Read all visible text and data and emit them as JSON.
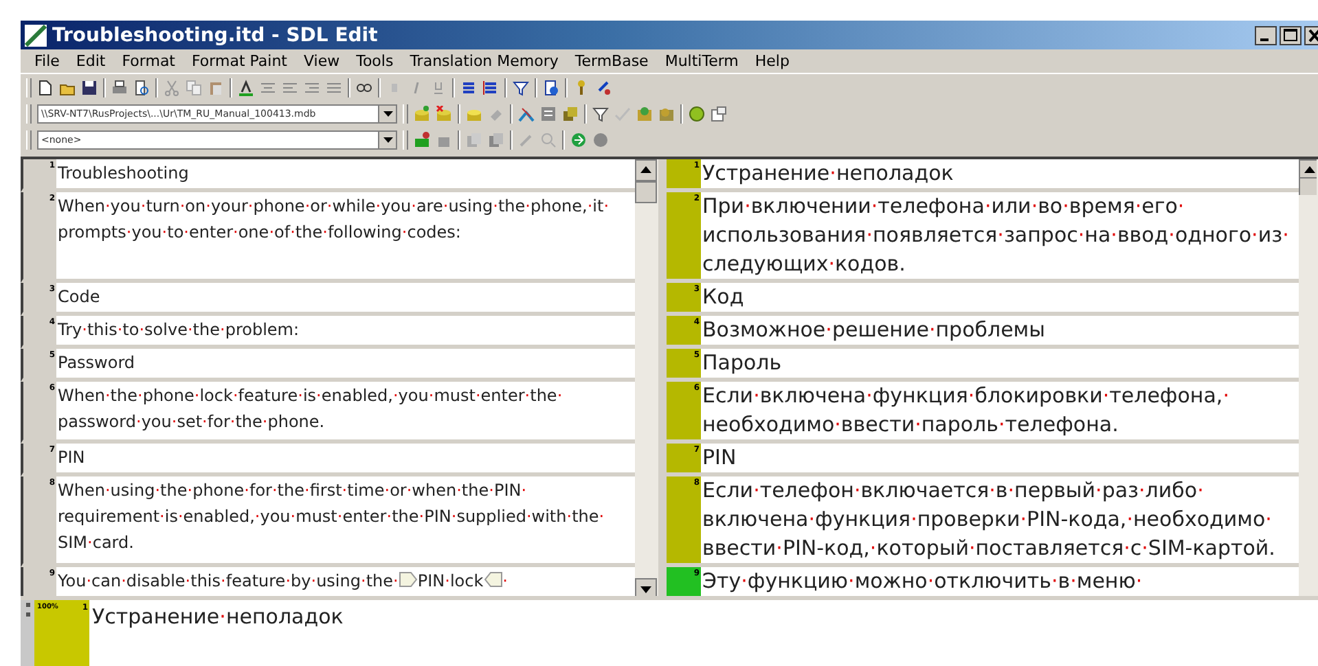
{
  "window": {
    "title": "Troubleshooting.itd - SDL Edit"
  },
  "menu": [
    "File",
    "Edit",
    "Format",
    "Format Paint",
    "View",
    "Tools",
    "Translation Memory",
    "TermBase",
    "MultiTerm",
    "Help"
  ],
  "toolbar": {
    "tm_path": "\\\\SRV-NT7\\RusProjects\\...\\Ur\\TM_RU_Manual_100413.mdb",
    "termbase": "<none>"
  },
  "segments": [
    {
      "number": "1",
      "source": [
        {
          "kind": "text",
          "text": "Troubleshooting"
        }
      ],
      "target_number": "1",
      "target": "Устранение·неполадок",
      "color": "#b5b800"
    },
    {
      "number": "2",
      "source": [
        {
          "kind": "text",
          "text": "When·you·turn·on·your·phone·or·while·you·are·using·the·phone,·it·prompts·you·to·enter·one·of·the·following·codes:"
        }
      ],
      "target_number": "2",
      "target": "При·включении·телефона·или·во·время·его·использования·появляется·запрос·на·ввод·одного·из·следующих·кодов.",
      "color": "#b5b800"
    },
    {
      "number": "3",
      "source": [
        {
          "kind": "text",
          "text": "Code"
        }
      ],
      "target_number": "3",
      "target": "Код",
      "color": "#b5b800"
    },
    {
      "number": "4",
      "source": [
        {
          "kind": "text",
          "text": "Try·this·to·solve·the·problem:"
        }
      ],
      "target_number": "4",
      "target": "Возможное·решение·проблемы",
      "color": "#b5b800"
    },
    {
      "number": "5",
      "source": [
        {
          "kind": "text",
          "text": "Password"
        }
      ],
      "target_number": "5",
      "target": "Пароль",
      "color": "#b5b800"
    },
    {
      "number": "6",
      "source": [
        {
          "kind": "text",
          "text": "When·the·phone·lock·feature·is·enabled,·you·must·enter·the·password·you·set·for·the·phone."
        }
      ],
      "target_number": "6",
      "target": "Если·включена·функция·блокировки·телефона,·необходимо·ввести·пароль·телефона.",
      "color": "#b5b800"
    },
    {
      "number": "7",
      "source": [
        {
          "kind": "text",
          "text": "PIN"
        }
      ],
      "target_number": "7",
      "target": "PIN",
      "color": "#b5b800"
    },
    {
      "number": "8",
      "source": [
        {
          "kind": "text",
          "text": "When·using·the·phone·for·the·first·time·or·when·the·PIN·requirement·is·enabled,·you·must·enter·the·PIN·supplied·with·the·SIM·card."
        }
      ],
      "target_number": "8",
      "target": "Если·телефон·включается·в·первый·раз·либо·включена·функция·проверки·PIN-кода,·необходимо·ввести·PIN-код,·который·поставляется·с·SIM-картой.",
      "color": "#b5b800"
    },
    {
      "number": "9",
      "source": [
        {
          "kind": "text",
          "text": "You·can·disable·this·feature·by·using·the·"
        },
        {
          "kind": "tag_open"
        },
        {
          "kind": "text",
          "text": "PIN·lock"
        },
        {
          "kind": "tag_close"
        },
        {
          "kind": "text",
          "text": "·"
        }
      ],
      "target_number": "9",
      "target": "Эту·функцию·можно·отключить·в·меню·",
      "color": "#22c022"
    }
  ],
  "preview": {
    "match": "100%",
    "number": "1",
    "text": "Устранение·неполадок",
    "color": "#c8c800"
  }
}
